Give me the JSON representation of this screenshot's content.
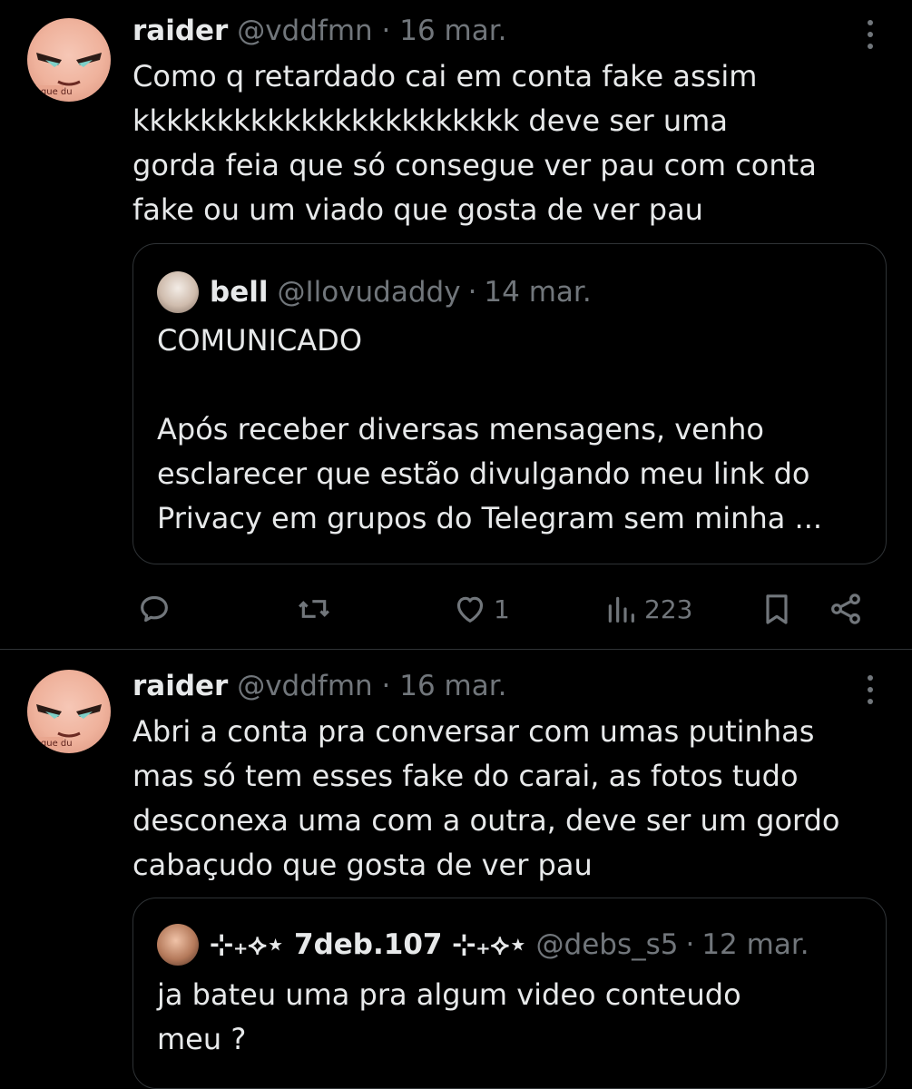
{
  "tweets": [
    {
      "name": "raider",
      "handle": "@vddfmn",
      "separator": "·",
      "date": "16 mar.",
      "avatar_icon": "anime-face-avatar",
      "text": "Como q retardado cai em conta fake assim\nkkkkkkkkkkkkkkkkkkkkkkk deve ser uma\ngorda feia que só consegue ver pau com conta\nfake ou um viado que gosta de ver pau",
      "quote": {
        "name": "bell",
        "handle": "@Ilovudaddy",
        "separator": "·",
        "date": "14 mar.",
        "text": "COMUNICADO\n\nApós receber diversas mensagens, venho\nesclarecer que estão divulgando meu link do\nPrivacy em grupos do Telegram sem minha ..."
      },
      "actions": {
        "reply_icon": "reply-icon",
        "retweet_icon": "retweet-icon",
        "like_icon": "heart-icon",
        "like_count": "1",
        "views_icon": "views-icon",
        "views_count": "223",
        "bookmark_icon": "bookmark-icon",
        "share_icon": "share-icon"
      }
    },
    {
      "name": "raider",
      "handle": "@vddfmn",
      "separator": "·",
      "date": "16 mar.",
      "avatar_icon": "anime-face-avatar",
      "text": "Abri a conta pra conversar com umas putinhas\nmas só tem esses fake do carai, as fotos tudo\ndesconexa uma com a outra, deve ser um gordo\ncabaçudo que gosta de ver pau",
      "quote": {
        "name": "⊹₊⟡⋆ 7deb.107 ⊹₊⟡⋆",
        "handle": "@debs_s5",
        "separator": "·",
        "date": "12 mar.",
        "text": "ja bateu uma pra algum video conteudo\nmeu ?"
      }
    }
  ],
  "colors": {
    "background": "#000000",
    "text": "#e7e9ea",
    "muted": "#71767b",
    "border": "#2f3336"
  }
}
